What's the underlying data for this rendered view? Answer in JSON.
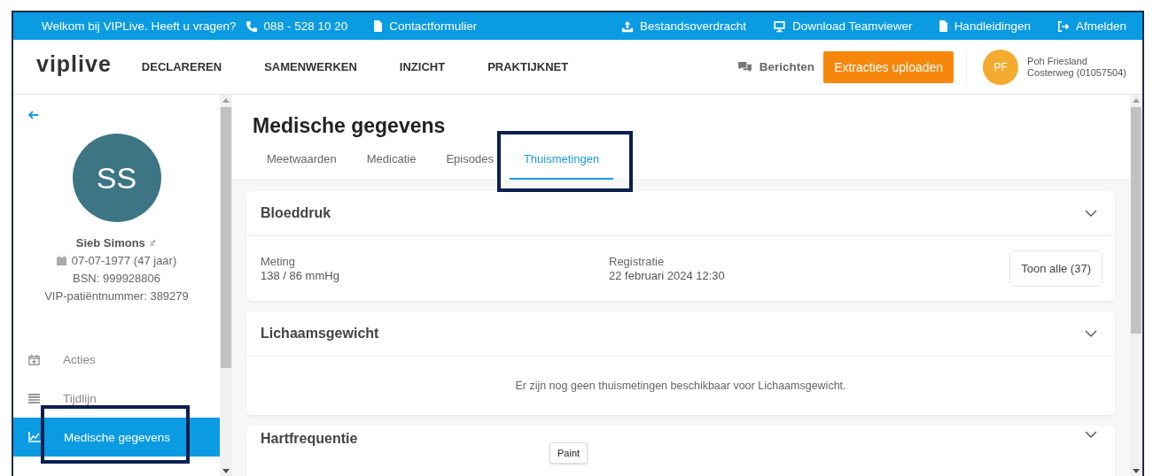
{
  "topbar": {
    "welcome": "Welkom bij VIPLive. Heeft u vragen?",
    "left_links": [
      {
        "label": "088 - 528 10 20"
      },
      {
        "label": "Contactformulier"
      }
    ],
    "right_links": [
      {
        "label": "Bestandsoverdracht"
      },
      {
        "label": "Download Teamviewer"
      },
      {
        "label": "Handleidingen"
      },
      {
        "label": "Afmelden"
      }
    ]
  },
  "header": {
    "logo": "viplive",
    "nav": [
      "DECLAREREN",
      "SAMENWERKEN",
      "INZICHT",
      "PRAKTIJKNET"
    ],
    "messages": "Berichten",
    "upload_button": "Extracties uploaden",
    "user": {
      "initials": "PF",
      "name": "Poh Friesland",
      "location": "Costerweg (01057504)"
    }
  },
  "sidebar": {
    "patient": {
      "initials": "SS",
      "name": "Sieb Simons",
      "gender": "♂",
      "birth_date": "07-07-1977  (47 jaar)",
      "bsn": "BSN: 999928806",
      "vip_number": "VIP-patiëntnummer: 389279"
    },
    "items": [
      {
        "label": "Acties",
        "selected": false,
        "highlighted": false
      },
      {
        "label": "Tijdlijn",
        "selected": false,
        "highlighted": false
      },
      {
        "label": "Medische gegevens",
        "selected": true,
        "highlighted": true
      }
    ]
  },
  "page": {
    "title": "Medische gegevens",
    "tabs": [
      {
        "label": "Meetwaarden",
        "selected": false,
        "highlighted": false
      },
      {
        "label": "Medicatie",
        "selected": false,
        "highlighted": false
      },
      {
        "label": "Episodes",
        "selected": false,
        "highlighted": false
      },
      {
        "label": "Thuismetingen",
        "selected": true,
        "highlighted": true
      }
    ],
    "cards": [
      {
        "kind": "measurement",
        "title": "Bloeddruk",
        "fields": [
          {
            "label": "Meting",
            "value": "138 / 86 mmHg"
          },
          {
            "label": "Registratie",
            "value": "22 februari 2024 12:30"
          }
        ],
        "button": "Toon alle (37)"
      },
      {
        "kind": "empty",
        "title": "Lichaamsgewicht",
        "message": "Er zijn nog geen thuismetingen beschikbaar voor Lichaamsgewicht."
      },
      {
        "kind": "header",
        "title": "Hartfrequentie"
      }
    ]
  },
  "tooltip": "Paint"
}
